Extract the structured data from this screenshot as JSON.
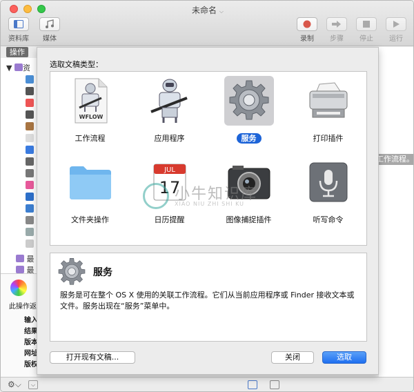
{
  "window": {
    "title": "未命名"
  },
  "toolbar": {
    "left": [
      {
        "label": "资料库",
        "icon": "library-icon"
      },
      {
        "label": "媒体",
        "icon": "media-icon"
      }
    ],
    "right": [
      {
        "label": "录制",
        "icon": "record-icon"
      },
      {
        "label": "步骤",
        "icon": "step-icon"
      },
      {
        "label": "停止",
        "icon": "stop-icon"
      },
      {
        "label": "运行",
        "icon": "run-icon"
      }
    ]
  },
  "library": {
    "tab_label": "操作",
    "root_label": "资",
    "items": [
      "最",
      "最"
    ]
  },
  "background_desc": {
    "label": "此操作返",
    "fields": [
      "输入",
      "结果",
      "版本",
      "网址",
      "版权"
    ]
  },
  "right_hint": "工作流程。",
  "sheet": {
    "prompt": "选取文稿类型：",
    "items": [
      {
        "label": "工作流程",
        "icon": "workflow-robot-icon",
        "badge": "WFLOW",
        "selected": false
      },
      {
        "label": "应用程序",
        "icon": "automator-robot-icon",
        "selected": false
      },
      {
        "label": "服务",
        "icon": "gear-icon",
        "selected": true
      },
      {
        "label": "打印插件",
        "icon": "printer-icon",
        "selected": false
      },
      {
        "label": "文件夹操作",
        "icon": "folder-icon",
        "selected": false
      },
      {
        "label": "日历提醒",
        "icon": "calendar-icon",
        "cal_month": "JUL",
        "cal_day": "17",
        "selected": false
      },
      {
        "label": "图像捕捉插件",
        "icon": "camera-icon",
        "selected": false
      },
      {
        "label": "听写命令",
        "icon": "microphone-icon",
        "selected": false
      }
    ],
    "description": {
      "title": "服务",
      "text": "服务是可在整个 OS X 使用的关联工作流程。它们从当前应用程序或 Finder 接收文本或文件。服务出现在“服务”菜单中。"
    },
    "buttons": {
      "open_existing": "打开现有文稿...",
      "close": "关闭",
      "choose": "选取"
    }
  },
  "watermark": {
    "text": "小牛知识库",
    "sub": "XIAO NIU ZHI SHI KU"
  },
  "colors": {
    "accent": "#1d64d8",
    "selection_bg": "#cfcfd2"
  }
}
